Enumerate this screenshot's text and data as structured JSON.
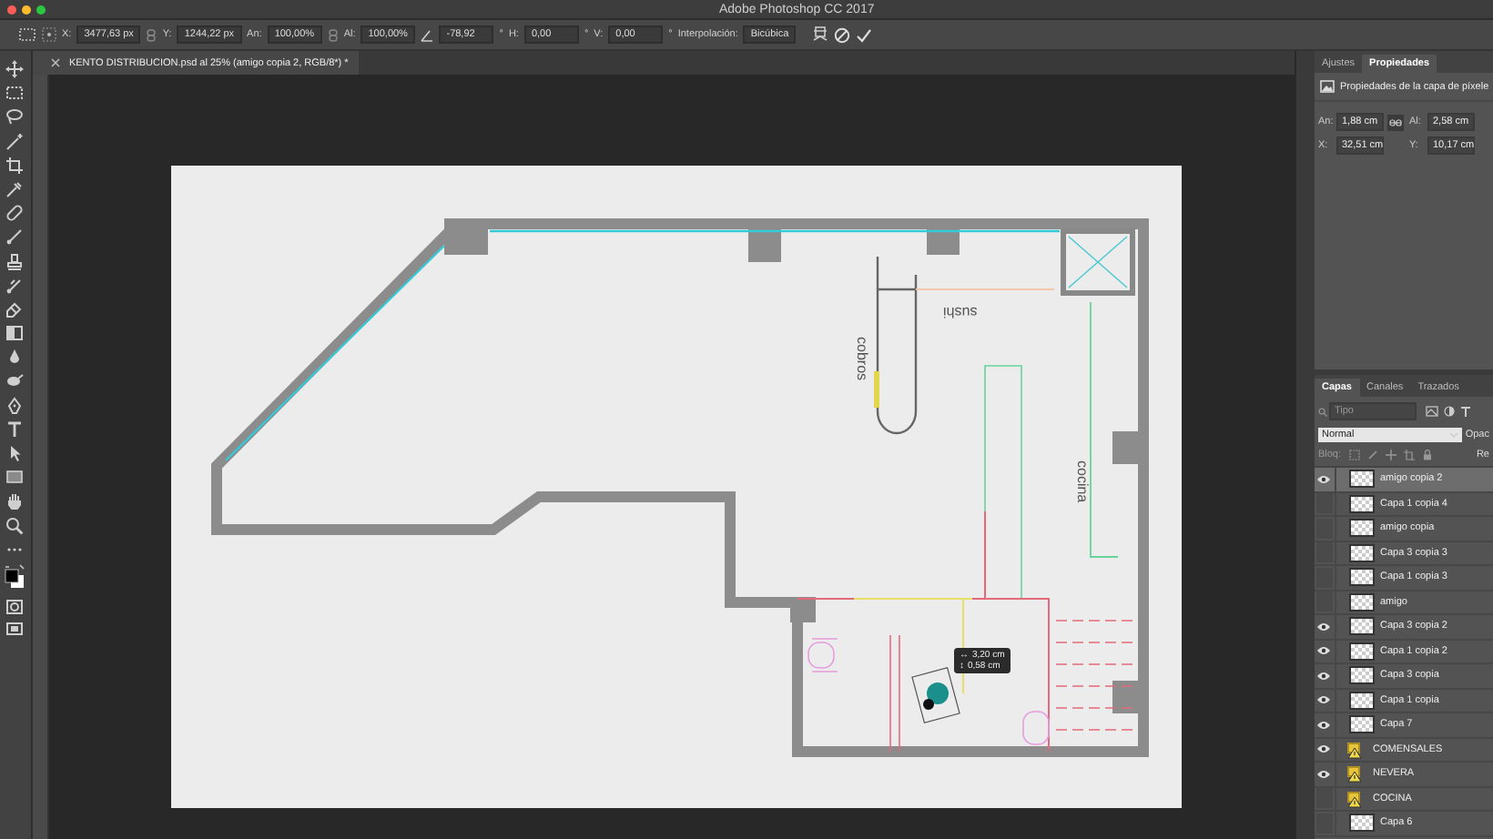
{
  "window": {
    "title": "Adobe Photoshop CC 2017"
  },
  "options_bar": {
    "items": [
      {
        "kind": "field",
        "label": "X:",
        "value": "3477,63 px"
      },
      {
        "kind": "link"
      },
      {
        "kind": "field",
        "label": "Y:",
        "value": "1244,22 px"
      },
      {
        "kind": "field",
        "label": "An:",
        "value": "100,00%"
      },
      {
        "kind": "link"
      },
      {
        "kind": "field",
        "label": "Al:",
        "value": "100,00%"
      },
      {
        "kind": "angle",
        "value": "-78,92",
        "unit": "°"
      },
      {
        "kind": "field",
        "label": "H:",
        "value": "0,00",
        "unit": "°"
      },
      {
        "kind": "field",
        "label": "V:",
        "value": "0,00",
        "unit": "°"
      },
      {
        "kind": "dropdown",
        "label": "Interpolación:",
        "value": "Bicúbica"
      }
    ]
  },
  "document_tab": {
    "title": "KENTO DISTRIBUCION.psd al 25% (amigo copia 2, RGB/8*) *"
  },
  "canvas": {
    "labels": [
      {
        "text": "sushi",
        "kind": "upside-down"
      },
      {
        "text": "cobros",
        "kind": "vertical"
      },
      {
        "text": "cocina",
        "kind": "vertical"
      }
    ],
    "readout": [
      {
        "symbol": "↔",
        "value": "3,20 cm"
      },
      {
        "symbol": "↕",
        "value": "0,58 cm"
      }
    ]
  },
  "properties_panel": {
    "tabs": [
      {
        "label": "Ajustes",
        "selected": false
      },
      {
        "label": "Propiedades",
        "selected": true
      }
    ],
    "heading": "Propiedades de la capa de píxele",
    "fields": [
      {
        "label": "An:",
        "value": "1,88 cm"
      },
      {
        "label": "Al:",
        "value": "2,58 cm"
      },
      {
        "label": "X:",
        "value": "32,51 cm"
      },
      {
        "label": "Y:",
        "value": "10,17 cm"
      }
    ]
  },
  "layers_panel": {
    "tabs": [
      {
        "label": "Capas",
        "selected": true
      },
      {
        "label": "Canales",
        "selected": false
      },
      {
        "label": "Trazados",
        "selected": false
      }
    ],
    "search": {
      "placeholder": "Tipo"
    },
    "blend_mode": "Normal",
    "opacity_label": "Opac",
    "lock_label": "Bloq:",
    "fill_label": "Re",
    "layers": [
      {
        "name": "amigo copia 2",
        "kind": "pixel",
        "visible": true,
        "selected": true
      },
      {
        "name": "Capa 1 copia 4",
        "kind": "pixel",
        "visible": false,
        "selected": false
      },
      {
        "name": "amigo copia",
        "kind": "pixel",
        "visible": false,
        "selected": false
      },
      {
        "name": "Capa 3 copia 3",
        "kind": "pixel",
        "visible": false,
        "selected": false
      },
      {
        "name": "Capa 1 copia 3",
        "kind": "pixel",
        "visible": false,
        "selected": false
      },
      {
        "name": "amigo",
        "kind": "pixel",
        "visible": false,
        "selected": false
      },
      {
        "name": "Capa 3 copia 2",
        "kind": "pixel",
        "visible": true,
        "selected": false
      },
      {
        "name": "Capa 1 copia 2",
        "kind": "pixel",
        "visible": true,
        "selected": false
      },
      {
        "name": "Capa 3 copia",
        "kind": "pixel",
        "visible": true,
        "selected": false
      },
      {
        "name": "Capa 1 copia",
        "kind": "pixel",
        "visible": true,
        "selected": false
      },
      {
        "name": "Capa 7",
        "kind": "pixel",
        "visible": true,
        "selected": false
      },
      {
        "name": "COMENSALES",
        "kind": "smart",
        "visible": true,
        "selected": false
      },
      {
        "name": "NEVERA",
        "kind": "smart",
        "visible": true,
        "selected": false
      },
      {
        "name": "COCINA",
        "kind": "smart",
        "visible": false,
        "selected": false
      },
      {
        "name": "Capa 6",
        "kind": "pixel",
        "visible": false,
        "selected": false
      }
    ]
  }
}
